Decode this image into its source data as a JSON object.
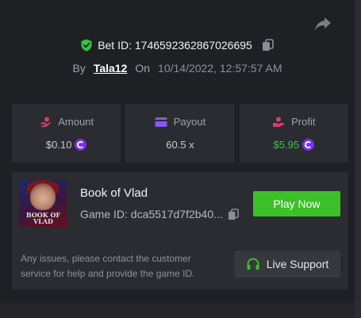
{
  "bet": {
    "label": "Bet ID: 1746592362867026695"
  },
  "by": {
    "by_label": "By",
    "username": "Tala12",
    "on_label": "On",
    "datetime": "10/14/2022, 12:57:57 AM"
  },
  "stats": [
    {
      "label": "Amount",
      "value": "$0.10",
      "icon": "hand-coin-icon",
      "show_coin": true
    },
    {
      "label": "Payout",
      "value": "60.5 x",
      "icon": "wallet-icon",
      "show_coin": false
    },
    {
      "label": "Profit",
      "value": "$5.95",
      "icon": "hand-money-icon",
      "show_coin": true
    }
  ],
  "game": {
    "title": "Book of Vlad",
    "id_label": "Game ID: dca5517d7f2b40...",
    "thumb_text": "BOOK OF VLAD",
    "play_label": "Play Now"
  },
  "support": {
    "notice": "Any issues, please contact the customer service for help and provide the game ID.",
    "button_label": "Live Support"
  },
  "colors": {
    "accent_green": "#3cc02a",
    "profit_green": "#3ec24a",
    "icon_pink": "#e03a6a",
    "icon_purple": "#8b55f7",
    "coin_purple": "#7b2ff0",
    "panel": "#1f2024",
    "card": "#2a2c31"
  }
}
